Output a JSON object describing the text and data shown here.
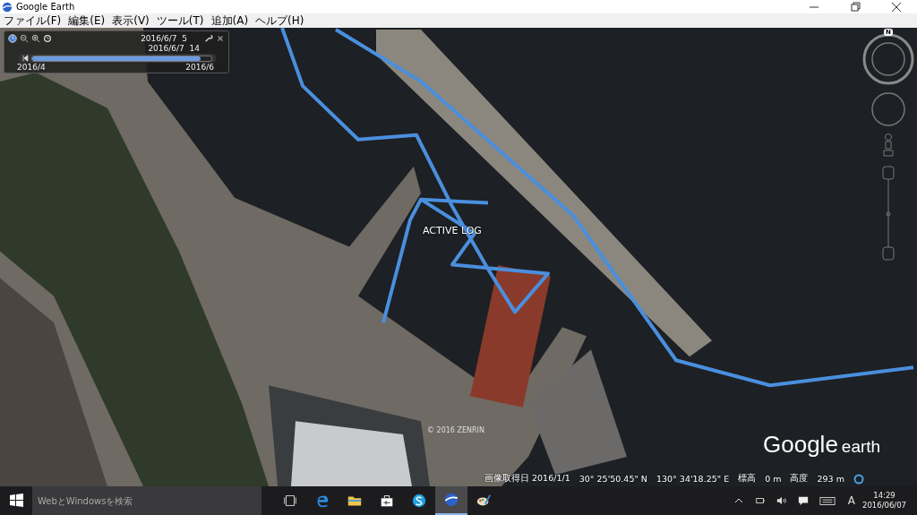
{
  "window": {
    "title": "Google Earth"
  },
  "menu": [
    "ファイル(F)",
    "編集(E)",
    "表示(V)",
    "ツール(T)",
    "追加(A)",
    "ヘルプ(H)"
  ],
  "time_slider": {
    "start": "2016/6/7  5",
    "end": "2016/6/7  14",
    "range_start": "2016/4",
    "range_end": "2016/6",
    "level": 0.94
  },
  "map": {
    "track_label": "ACTIVE LOG",
    "copyright": "© 2016 ZENRIN",
    "compass_north": "N",
    "logo_word_1": "Google",
    "logo_word_2": "earth"
  },
  "status_bar": {
    "imagery_date": "画像取得日 2016/1/1",
    "latitude": "30° 25'50.45\" N",
    "longitude": "130° 34'18.25\" E",
    "elevation_label": "標高",
    "elevation": "0 m",
    "altitude_label": "高度",
    "altitude": "293 m"
  },
  "taskbar": {
    "search_placeholder": "WebとWindowsを検索",
    "apps": [
      {
        "kind": "task-view",
        "selected": false
      },
      {
        "kind": "edge",
        "selected": false
      },
      {
        "kind": "explorer",
        "selected": false
      },
      {
        "kind": "store",
        "selected": false
      },
      {
        "kind": "skype",
        "selected": false
      },
      {
        "kind": "earth",
        "selected": true
      },
      {
        "kind": "paint",
        "selected": false
      }
    ],
    "ime": "A",
    "time": "14:29",
    "date": "2016/06/07"
  }
}
